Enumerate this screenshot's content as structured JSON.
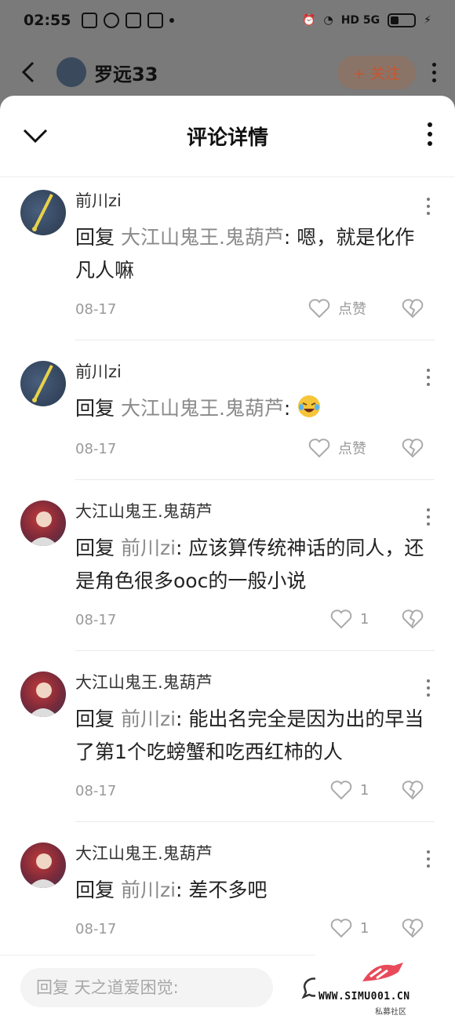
{
  "status_bar": {
    "time": "02:55",
    "network": "HD 5G"
  },
  "background_header": {
    "name": "罗远33",
    "follow_label": "+ 关注"
  },
  "sheet": {
    "title": "评论详情"
  },
  "comments": [
    {
      "author": "前川zi",
      "reply_keyword": "回复",
      "target": "大江山鬼王.鬼葫芦",
      "text": ": 嗯，就是化作凡人嘛",
      "date": "08-17",
      "like_label": "点赞"
    },
    {
      "author": "前川zi",
      "reply_keyword": "回复",
      "target": "大江山鬼王.鬼葫芦",
      "text": ": ",
      "date": "08-17",
      "like_label": "点赞"
    },
    {
      "author": "大江山鬼王.鬼葫芦",
      "reply_keyword": "回复",
      "target": "前川zi",
      "text": ": 应该算传统神话的同人，还是角色很多ooc的一般小说",
      "date": "08-17",
      "like_label": "1"
    },
    {
      "author": "大江山鬼王.鬼葫芦",
      "reply_keyword": "回复",
      "target": "前川zi",
      "text": ": 能出名完全是因为出的早当了第1个吃螃蟹和吃西红柿的人",
      "date": "08-17",
      "like_label": "1"
    },
    {
      "author": "大江山鬼王.鬼葫芦",
      "reply_keyword": "回复",
      "target": "前川zi",
      "text": ": 差不多吧",
      "date": "08-17",
      "like_label": "1"
    }
  ],
  "reply_bar": {
    "placeholder": "回复 天之道爱困觉:"
  },
  "watermark": {
    "url": "WWW.SIMU001.CN",
    "subtitle": "私募社区"
  }
}
